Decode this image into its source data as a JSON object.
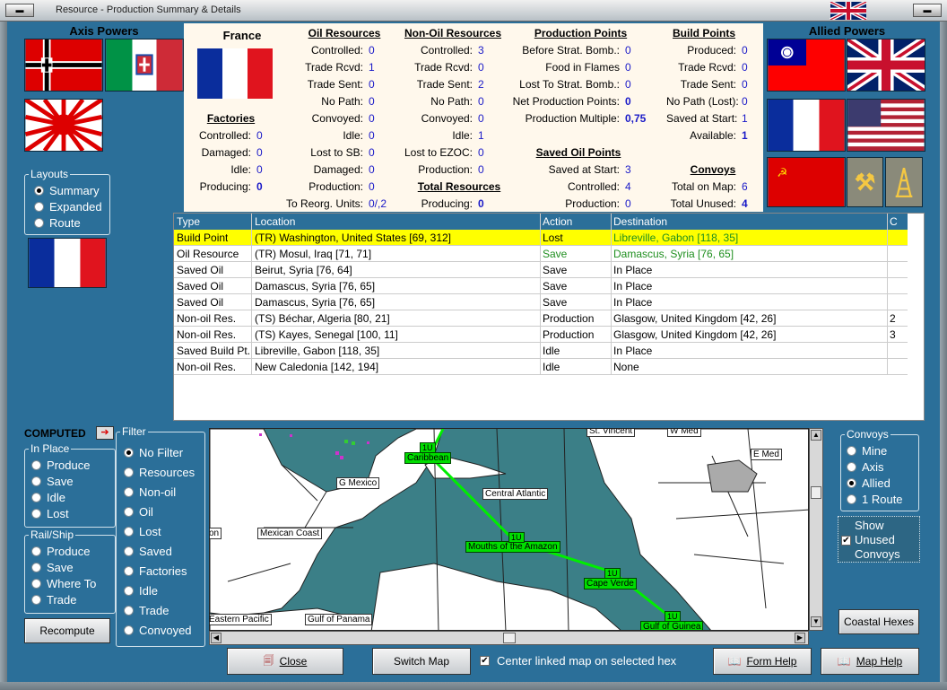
{
  "window": {
    "title": "Resource - Production Summary & Details"
  },
  "axis": {
    "header": "Axis Powers"
  },
  "allied": {
    "header": "Allied Powers"
  },
  "summary": {
    "country": "France",
    "factories": {
      "title": "Factories",
      "rows": [
        {
          "label": "Controlled:",
          "value": "0"
        },
        {
          "label": "Damaged:",
          "value": "0"
        },
        {
          "label": "Idle:",
          "value": "0"
        },
        {
          "label": "Producing:",
          "value": "0"
        }
      ]
    },
    "oil": {
      "title": "Oil Resources",
      "rows": [
        {
          "label": "Controlled:",
          "value": "0"
        },
        {
          "label": "Trade Rcvd:",
          "value": "1"
        },
        {
          "label": "Trade Sent:",
          "value": "0"
        },
        {
          "label": "No Path:",
          "value": "0"
        },
        {
          "label": "Convoyed:",
          "value": "0"
        },
        {
          "label": "Idle:",
          "value": "0"
        },
        {
          "label": "Lost to SB:",
          "value": "0"
        },
        {
          "label": "Damaged:",
          "value": "0"
        },
        {
          "label": "Production:",
          "value": "0"
        },
        {
          "label": "To Reorg. Units:",
          "value": "0/,2"
        }
      ]
    },
    "nonoil": {
      "title": "Non-Oil Resources",
      "rows": [
        {
          "label": "Controlled:",
          "value": "3"
        },
        {
          "label": "Trade Rcvd:",
          "value": "0"
        },
        {
          "label": "Trade Sent:",
          "value": "2"
        },
        {
          "label": "No Path:",
          "value": "0"
        },
        {
          "label": "Convoyed:",
          "value": "0"
        },
        {
          "label": "Idle:",
          "value": "1"
        },
        {
          "label": "Lost to EZOC:",
          "value": "0"
        },
        {
          "label": "Production:",
          "value": "0"
        }
      ]
    },
    "total": {
      "title": "Total Resources",
      "rows": [
        {
          "label": "Producing:",
          "value": "0"
        }
      ]
    },
    "pp": {
      "title": "Production Points",
      "rows": [
        {
          "label": "Before Strat. Bomb.:",
          "value": "0"
        },
        {
          "label": "Food in Flames",
          "value": "0"
        },
        {
          "label": "Lost To Strat. Bomb.:",
          "value": "0"
        },
        {
          "label": "Net Production Points:",
          "value": "0"
        },
        {
          "label": "Production Multiple:",
          "value": "0,75"
        }
      ]
    },
    "savedoil": {
      "title": "Saved Oil Points",
      "rows": [
        {
          "label": "Saved at Start:",
          "value": "3"
        },
        {
          "label": "Controlled:",
          "value": "4"
        },
        {
          "label": "Production:",
          "value": "0"
        }
      ]
    },
    "bp": {
      "title": "Build Points",
      "rows": [
        {
          "label": "Produced:",
          "value": "0"
        },
        {
          "label": "Trade Rcvd:",
          "value": "0"
        },
        {
          "label": "Trade Sent:",
          "value": "0"
        },
        {
          "label": "No Path (Lost):",
          "value": "0"
        },
        {
          "label": "Saved at Start:",
          "value": "1"
        },
        {
          "label": "Available:",
          "value": "1"
        }
      ]
    },
    "convoys": {
      "title": "Convoys",
      "rows": [
        {
          "label": "Total on Map:",
          "value": "6"
        },
        {
          "label": "Total Unused:",
          "value": "4"
        }
      ]
    }
  },
  "layouts": {
    "title": "Layouts",
    "options": [
      "Summary",
      "Expanded",
      "Route"
    ],
    "selected": 0
  },
  "table": {
    "columns": [
      "Type",
      "Location",
      "Action",
      "Destination",
      "C"
    ],
    "rows": [
      [
        "Build Point",
        "(TR) Washington, United States [69, 312]",
        "Lost",
        "Libreville, Gabon [118, 35]",
        ""
      ],
      [
        "Oil Resource",
        "(TR) Mosul, Iraq [71, 71]",
        "Save",
        "Damascus, Syria [76, 65]",
        ""
      ],
      [
        "Saved Oil",
        "Beirut, Syria [76, 64]",
        "Save",
        "In Place",
        ""
      ],
      [
        "Saved Oil",
        "Damascus, Syria [76, 65]",
        "Save",
        "In Place",
        ""
      ],
      [
        "Saved Oil",
        "Damascus, Syria [76, 65]",
        "Save",
        "In Place",
        ""
      ],
      [
        "Non-oil Res.",
        "(TS) Béchar, Algeria [80, 21]",
        "Production",
        "Glasgow, United Kingdom [42, 26]",
        "2"
      ],
      [
        "Non-oil Res.",
        "(TS) Kayes, Senegal [100, 11]",
        "Production",
        "Glasgow, United Kingdom [42, 26]",
        "3"
      ],
      [
        "Saved Build Pt.",
        "Libreville, Gabon [118, 35]",
        "Idle",
        "In Place",
        ""
      ],
      [
        "Non-oil Res.",
        "New Caledonia [142, 194]",
        "Idle",
        "None",
        ""
      ]
    ],
    "selected_row": 0
  },
  "computed": {
    "label": "COMPUTED"
  },
  "inplace": {
    "title": "In Place",
    "options": [
      "Produce",
      "Save",
      "Idle",
      "Lost"
    ]
  },
  "railship": {
    "title": "Rail/Ship",
    "options": [
      "Produce",
      "Save",
      "Where To",
      "Trade"
    ]
  },
  "filter": {
    "title": "Filter",
    "options": [
      "No Filter",
      "Resources",
      "Non-oil",
      "Oil",
      "Lost",
      "Saved",
      "Factories",
      "Idle",
      "Trade",
      "Convoyed"
    ],
    "selected": 0
  },
  "convoys_panel": {
    "title": "Convoys",
    "options": [
      "Mine",
      "Axis",
      "Allied",
      "1 Route"
    ],
    "selected": 2
  },
  "show_unused": {
    "label": "Show Unused Convoys",
    "checked": true
  },
  "map": {
    "labels": [
      "St. Vincent",
      "W Med",
      "E Med",
      "G Mexico",
      "Central Atlantic",
      "Mexican Coast",
      "on",
      "Eastern Pacific",
      "Gulf of Panama"
    ],
    "sea_labels": [
      "Caribbean",
      "Mouths of the Amazon",
      "Cape Verde",
      "Gulf of Guinea"
    ],
    "convoy_badge": "1U"
  },
  "buttons": {
    "recompute": "Recompute",
    "close": "Close",
    "switch_map": "Switch Map",
    "center_linked": "Center linked map on selected hex",
    "form_help": "Form Help",
    "map_help": "Map Help",
    "coastal_hexes": "Coastal Hexes"
  },
  "colors": {
    "panel": "#2b6f99",
    "selected_row": "#ffff00",
    "value": "#1a1ac8",
    "convoy": "#00dd00",
    "sea": "#3b7f87"
  }
}
